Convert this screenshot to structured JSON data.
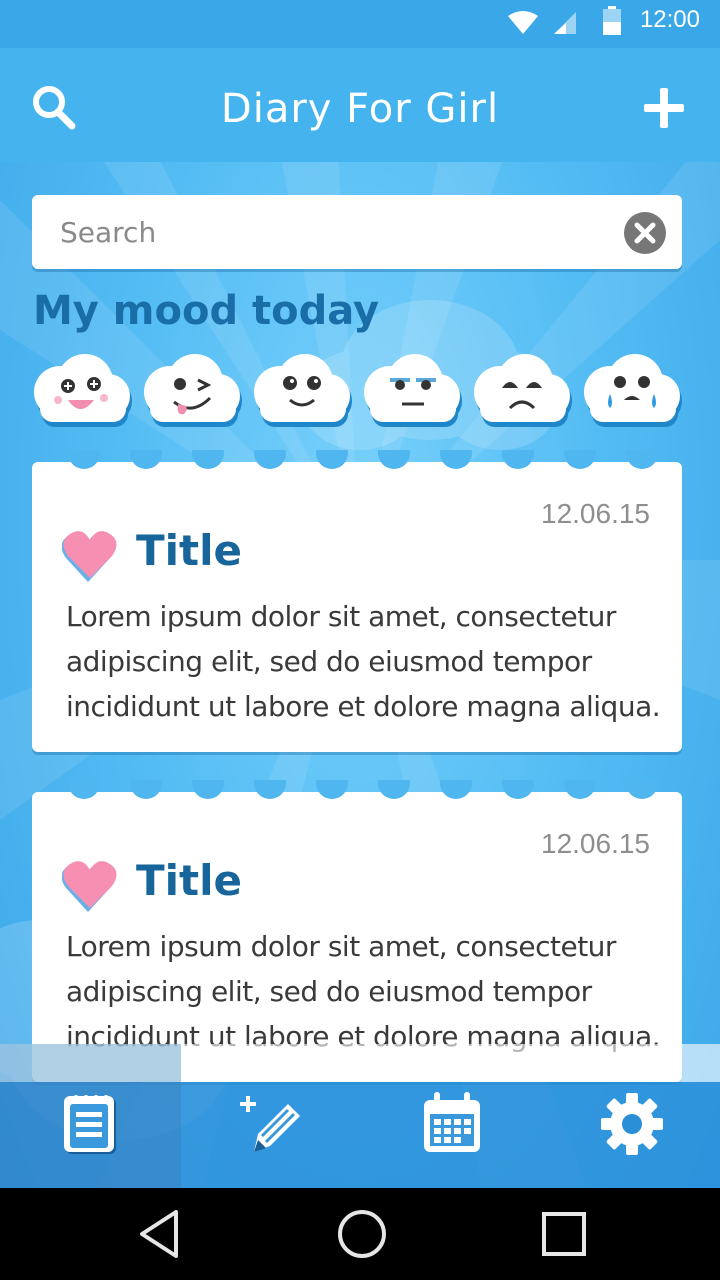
{
  "status_bar": {
    "time": "12:00"
  },
  "app_bar": {
    "title": "Diary For Girl",
    "search_icon": "search-icon",
    "add_icon": "plus-icon"
  },
  "search": {
    "placeholder": "Search",
    "value": ""
  },
  "mood": {
    "heading": "My mood today",
    "faces": [
      "delighted",
      "playful",
      "happy",
      "unimpressed",
      "sad",
      "crying"
    ]
  },
  "entries": [
    {
      "date": "12.06.15",
      "title": "Title",
      "lines": [
        "Lorem ipsum dolor sit amet, consectetur",
        "adipiscing elit, sed do eiusmod tempor",
        "incididunt ut labore et dolore magna aliqua."
      ]
    },
    {
      "date": "12.06.15",
      "title": "Title",
      "lines": [
        "Lorem ipsum dolor sit amet, consectetur",
        "adipiscing elit, sed do eiusmod tempor",
        "incididunt ut labore et dolore magna aliqua."
      ]
    }
  ],
  "bottom_nav": [
    "notebook-icon",
    "new-entry-icon",
    "calendar-icon",
    "settings-icon"
  ],
  "colors": {
    "accent": "#45b3ee",
    "title_blue": "#17659b",
    "heart": "#f78fb3"
  }
}
